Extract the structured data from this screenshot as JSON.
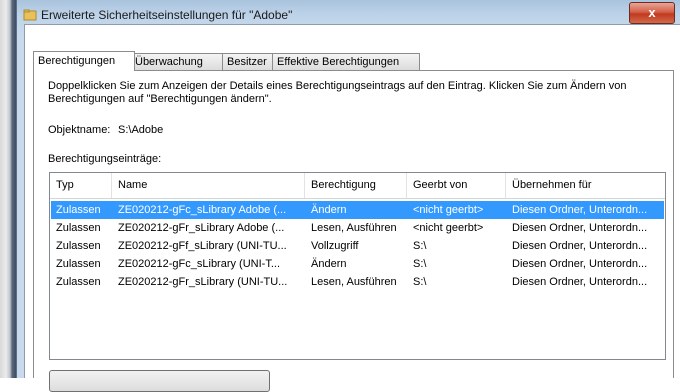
{
  "window": {
    "title": "Erweiterte Sicherheitseinstellungen für \"Adobe\"",
    "close_label": "x"
  },
  "tabs": [
    {
      "label": "Berechtigungen",
      "active": true
    },
    {
      "label": "Überwachung",
      "active": false
    },
    {
      "label": "Besitzer",
      "active": false
    },
    {
      "label": "Effektive Berechtigungen",
      "active": false
    }
  ],
  "description": "Doppelklicken Sie zum Anzeigen der Details eines Berechtigungseintrags auf den Eintrag. Klicken Sie zum Ändern von Berechtigungen auf \"Berechtigungen ändern\".",
  "object": {
    "label": "Objektname:",
    "value": "S:\\Adobe"
  },
  "entries_label": "Berechtigungseinträge:",
  "table": {
    "columns": [
      "Typ",
      "Name",
      "Berechtigung",
      "Geerbt von",
      "Übernehmen für"
    ],
    "rows": [
      {
        "typ": "Zulassen",
        "name": "ZE020212-gFc_sLibrary Adobe (...",
        "berechtigung": "Ändern",
        "geerbt": "<nicht geerbt>",
        "uebernehmen": "Diesen Ordner, Unterordn...",
        "selected": true
      },
      {
        "typ": "Zulassen",
        "name": "ZE020212-gFr_sLibrary Adobe (...",
        "berechtigung": "Lesen, Ausführen",
        "geerbt": "<nicht geerbt>",
        "uebernehmen": "Diesen Ordner, Unterordn...",
        "selected": false
      },
      {
        "typ": "Zulassen",
        "name": "ZE020212-gFf_sLibrary (UNI-TU...",
        "berechtigung": "Vollzugriff",
        "geerbt": "S:\\",
        "uebernehmen": "Diesen Ordner, Unterordn...",
        "selected": false
      },
      {
        "typ": "Zulassen",
        "name": "ZE020212-gFc_sLibrary (UNI-T...",
        "berechtigung": "Ändern",
        "geerbt": "S:\\",
        "uebernehmen": "Diesen Ordner, Unterordn...",
        "selected": false
      },
      {
        "typ": "Zulassen",
        "name": "ZE020212-gFr_sLibrary (UNI-TU...",
        "berechtigung": "Lesen, Ausführen",
        "geerbt": "S:\\",
        "uebernehmen": "Diesen Ordner, Unterordn...",
        "selected": false
      }
    ]
  },
  "colors": {
    "selection": "#3399ff",
    "frame": "#c8daeb",
    "close": "#c0391e"
  }
}
